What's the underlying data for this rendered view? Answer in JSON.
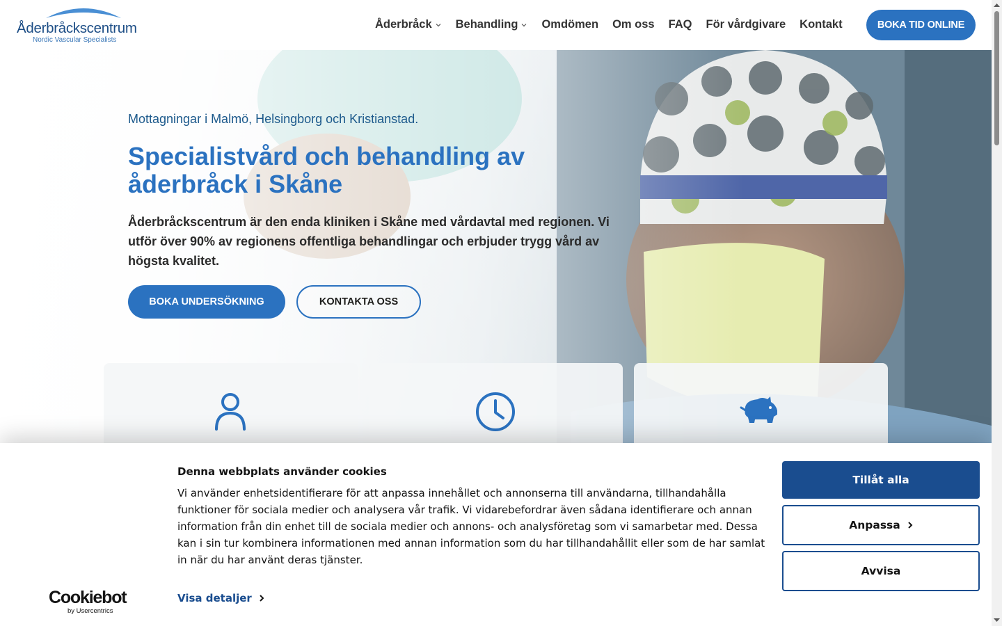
{
  "header": {
    "logo_title": "Åderbråckscentrum",
    "logo_subtitle": "Nordic Vascular Specialists",
    "nav": [
      {
        "label": "Åderbråck"
      },
      {
        "label": "Behandling"
      },
      {
        "label": "Omdömen"
      },
      {
        "label": "Om oss"
      },
      {
        "label": "FAQ"
      },
      {
        "label": "För vårdgivare"
      },
      {
        "label": "Kontakt"
      }
    ],
    "cta_label": "BOKA TID ONLINE"
  },
  "hero": {
    "subtitle": "Mottagningar i Malmö, Helsingborg och Kristianstad.",
    "title": "Specialistvård och behandling av åderbråck i Skåne",
    "body": "Åderbråckscentrum är den enda kliniken i Skåne med vårdavtal med regionen. Vi utför över 90% av regionens offentliga behandlingar och erbjuder trygg vård av högsta kvalitet.",
    "primary_button": "BOKA UNDERSÖKNING",
    "secondary_button": "KONTAKTA OSS"
  },
  "cards": [
    {
      "icon": "person-icon"
    },
    {
      "icon": "clock-icon"
    },
    {
      "icon": "piggy-bank-icon"
    }
  ],
  "cookie_banner": {
    "title": "Denna webbplats använder cookies",
    "text": "Vi använder enhetsidentifierare för att anpassa innehållet och annonserna till användarna, tillhandahålla funktioner för sociala medier och analysera vår trafik. Vi vidarebefordrar även sådana identifierare och annan information från din enhet till de sociala medier och annons- och analysföretag som vi samarbetar med. Dessa kan i sin tur kombinera informationen med annan information som du har tillhandahållit eller som de har samlat in när du har använt deras tjänster.",
    "details_link": "Visa detaljer",
    "allow_all": "Tillåt alla",
    "customize": "Anpassa",
    "deny": "Avvisa",
    "brand": "Cookiebot",
    "brand_sub": "by Usercentrics"
  },
  "colors": {
    "brand_blue": "#2b72c0",
    "dark_blue": "#1a4d8f",
    "logo_blue": "#1d4e86"
  }
}
